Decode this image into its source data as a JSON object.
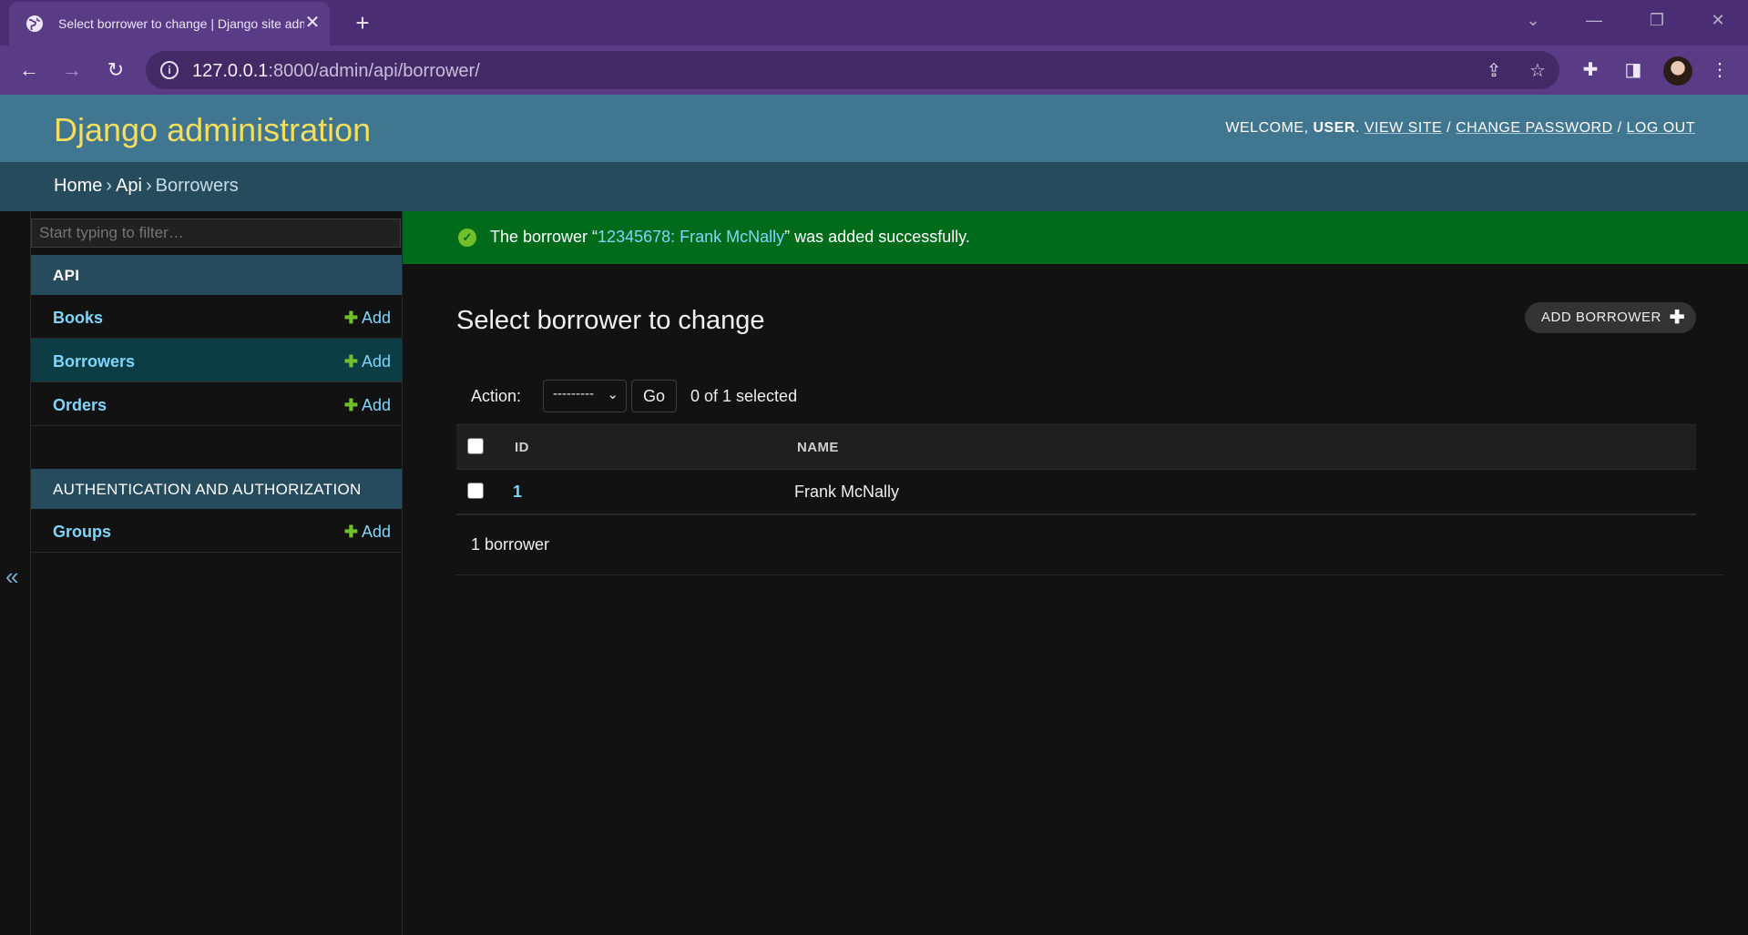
{
  "browser": {
    "tab_title": "Select borrower to change | Django site admin",
    "url_host": "127.0.0.1",
    "url_rest": ":8000/admin/api/borrower/"
  },
  "header": {
    "branding": "Django administration",
    "welcome": "WELCOME,",
    "username": "USER",
    "view_site": "VIEW SITE",
    "change_password": "CHANGE PASSWORD",
    "log_out": "LOG OUT"
  },
  "breadcrumbs": {
    "home": "Home",
    "app": "Api",
    "current": "Borrowers"
  },
  "sidebar": {
    "filter_placeholder": "Start typing to filter…",
    "collapse_glyph": "«",
    "apps": [
      {
        "caption": "API",
        "models": [
          {
            "name": "Books",
            "add": "Add"
          },
          {
            "name": "Borrowers",
            "add": "Add"
          },
          {
            "name": "Orders",
            "add": "Add"
          }
        ]
      },
      {
        "caption": "AUTHENTICATION AND AUTHORIZATION",
        "models": [
          {
            "name": "Groups",
            "add": "Add"
          }
        ]
      }
    ]
  },
  "message": {
    "prefix": "The borrower “",
    "link": "12345678: Frank McNally",
    "suffix": "” was added successfully."
  },
  "main": {
    "title": "Select borrower to change",
    "add_button": "ADD BORROWER",
    "action_label": "Action:",
    "action_selected": "---------",
    "go": "Go",
    "selected_count": "0 of 1 selected",
    "columns": [
      "ID",
      "NAME"
    ],
    "rows": [
      {
        "id": "1",
        "name": "Frank McNally"
      }
    ],
    "paginator": "1 borrower"
  },
  "colors": {
    "header_bg": "#417690",
    "branding": "#f5dd5d",
    "breadcrumb_bg": "#264b5d",
    "success_bg": "#006b1b",
    "link": "#81d4fa",
    "add_green": "#70bf2b",
    "browser_frame": "#4b2d74"
  }
}
